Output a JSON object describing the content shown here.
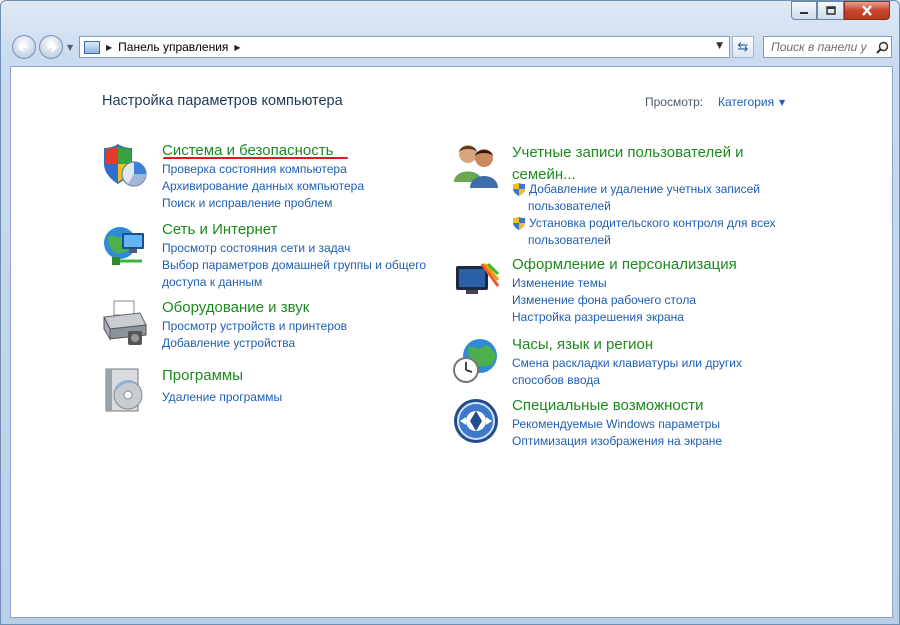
{
  "window": {
    "buttons": {
      "minimize": "minimize-icon",
      "maximize": "maximize-icon",
      "close": "close-icon"
    }
  },
  "nav": {
    "breadcrumb": "Панель управления",
    "search_placeholder": "Поиск в панели у"
  },
  "header": {
    "title": "Настройка параметров компьютера",
    "view_label": "Просмотр:",
    "view_value": "Категория"
  },
  "categories": [
    {
      "title": "Система и безопасность",
      "icon": "shield-icon",
      "links": [
        "Проверка состояния компьютера",
        "Архивирование данных компьютера",
        "Поиск и исправление проблем"
      ]
    },
    {
      "title": "Сеть и Интернет",
      "icon": "network-globe-icon",
      "links": [
        "Просмотр состояния сети и задач",
        "Выбор параметров домашней группы и общего",
        "доступа к данным"
      ]
    },
    {
      "title": "Оборудование и звук",
      "icon": "printer-icon",
      "links": [
        "Просмотр устройств и принтеров",
        "Добавление устройства"
      ]
    },
    {
      "title": "Программы",
      "icon": "programs-disc-icon",
      "links": [
        "Удаление программы"
      ]
    },
    {
      "title_line1": "Учетные записи пользователей и",
      "title_line2": "семейн...",
      "icon": "users-icon",
      "links": [
        "Добавление и удаление учетных записей",
        "пользователей",
        "Установка родительского контроля для всех",
        "пользователей"
      ]
    },
    {
      "title": "Оформление и персонализация",
      "icon": "appearance-monitor-icon",
      "links": [
        "Изменение темы",
        "Изменение фона рабочего стола",
        "Настройка разрешения экрана"
      ]
    },
    {
      "title": "Часы, язык и регион",
      "icon": "clock-globe-icon",
      "links": [
        "Смена раскладки клавиатуры или других",
        "способов ввода"
      ]
    },
    {
      "title": "Специальные возможности",
      "icon": "ease-of-access-icon",
      "links": [
        "Рекомендуемые Windows параметры",
        "Оптимизация изображения на экране"
      ]
    }
  ],
  "colors": {
    "title_green": "#1c8a1c",
    "link_blue": "#1e5eb3",
    "underline_red": "#e8141d"
  }
}
